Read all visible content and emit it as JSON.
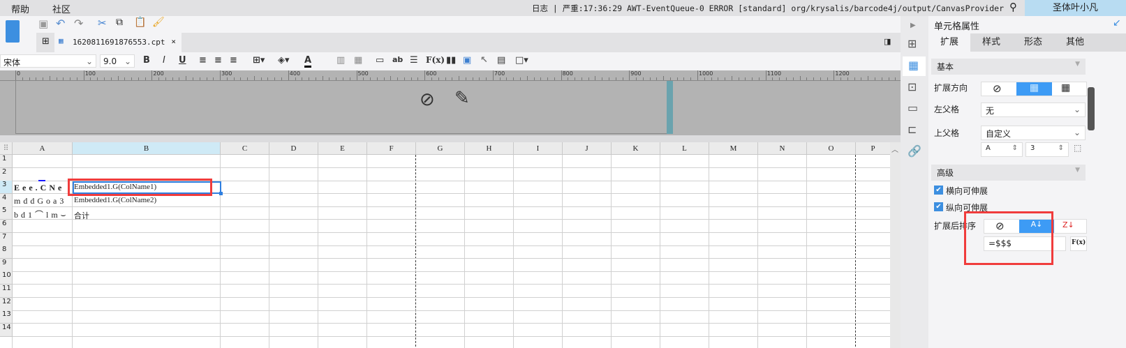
{
  "menubar": {
    "items": [
      "帮助",
      "社区"
    ],
    "log": "日志 | 严重:17:36:29 AWT-EventQueue-0 ERROR [standard] org/krysalis/barcode4j/output/CanvasProvider",
    "user": "圣体叶小凡"
  },
  "tab": {
    "filename": "1620811691876553.cpt",
    "close": "×"
  },
  "format": {
    "font": "宋体",
    "size": "9.0",
    "bold": "B",
    "italic": "I",
    "underline": "U"
  },
  "ruler": [
    "0",
    "100",
    "200",
    "300",
    "400",
    "500",
    "600",
    "700",
    "800",
    "900",
    "1000",
    "1100",
    "1200"
  ],
  "grid": {
    "columns": [
      "A",
      "B",
      "C",
      "D",
      "E",
      "F",
      "G",
      "H",
      "I",
      "J",
      "K",
      "L",
      "M",
      "N",
      "O",
      "P"
    ],
    "rows": [
      "1",
      "2",
      "3",
      "4",
      "5",
      "6",
      "7",
      "8",
      "9",
      "10",
      "11",
      "12",
      "13",
      "14"
    ],
    "selected_column": "B",
    "selected_row": "3",
    "cells": {
      "A3": "Eee.CNe",
      "A4": "mddGoa3",
      "A5": "bd1⌒lm⌣",
      "B3": "Embedded1.G(ColName1)",
      "B4": "Embedded1.G(ColName2)",
      "B5": "合计"
    }
  },
  "panel": {
    "title": "单元格属性",
    "tabs": [
      "扩展",
      "样式",
      "形态",
      "其他"
    ],
    "active_tab": "扩展",
    "basic": {
      "header": "基本",
      "direction_label": "扩展方向",
      "left_parent_label": "左父格",
      "left_parent_value": "无",
      "top_parent_label": "上父格",
      "top_parent_value": "自定义",
      "col_value": "A",
      "row_value": "3"
    },
    "advanced": {
      "header": "高级",
      "h_expand": "横向可伸展",
      "v_expand": "纵向可伸展",
      "sort_label": "扩展后排序",
      "formula": "=$$$",
      "fx": "F(x)"
    }
  },
  "colors": {
    "accent": "#3d9bf5",
    "highlight": "#f03c3c",
    "selection": "#2f7fe0"
  }
}
